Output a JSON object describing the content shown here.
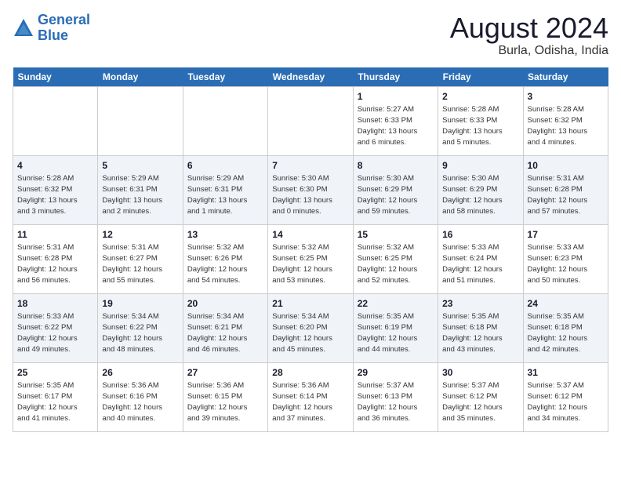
{
  "logo": {
    "text_general": "General",
    "text_blue": "Blue"
  },
  "title": {
    "month_year": "August 2024",
    "location": "Burla, Odisha, India"
  },
  "days_of_week": [
    "Sunday",
    "Monday",
    "Tuesday",
    "Wednesday",
    "Thursday",
    "Friday",
    "Saturday"
  ],
  "weeks": [
    [
      {
        "day": "",
        "info": ""
      },
      {
        "day": "",
        "info": ""
      },
      {
        "day": "",
        "info": ""
      },
      {
        "day": "",
        "info": ""
      },
      {
        "day": "1",
        "info": "Sunrise: 5:27 AM\nSunset: 6:33 PM\nDaylight: 13 hours\nand 6 minutes."
      },
      {
        "day": "2",
        "info": "Sunrise: 5:28 AM\nSunset: 6:33 PM\nDaylight: 13 hours\nand 5 minutes."
      },
      {
        "day": "3",
        "info": "Sunrise: 5:28 AM\nSunset: 6:32 PM\nDaylight: 13 hours\nand 4 minutes."
      }
    ],
    [
      {
        "day": "4",
        "info": "Sunrise: 5:28 AM\nSunset: 6:32 PM\nDaylight: 13 hours\nand 3 minutes."
      },
      {
        "day": "5",
        "info": "Sunrise: 5:29 AM\nSunset: 6:31 PM\nDaylight: 13 hours\nand 2 minutes."
      },
      {
        "day": "6",
        "info": "Sunrise: 5:29 AM\nSunset: 6:31 PM\nDaylight: 13 hours\nand 1 minute."
      },
      {
        "day": "7",
        "info": "Sunrise: 5:30 AM\nSunset: 6:30 PM\nDaylight: 13 hours\nand 0 minutes."
      },
      {
        "day": "8",
        "info": "Sunrise: 5:30 AM\nSunset: 6:29 PM\nDaylight: 12 hours\nand 59 minutes."
      },
      {
        "day": "9",
        "info": "Sunrise: 5:30 AM\nSunset: 6:29 PM\nDaylight: 12 hours\nand 58 minutes."
      },
      {
        "day": "10",
        "info": "Sunrise: 5:31 AM\nSunset: 6:28 PM\nDaylight: 12 hours\nand 57 minutes."
      }
    ],
    [
      {
        "day": "11",
        "info": "Sunrise: 5:31 AM\nSunset: 6:28 PM\nDaylight: 12 hours\nand 56 minutes."
      },
      {
        "day": "12",
        "info": "Sunrise: 5:31 AM\nSunset: 6:27 PM\nDaylight: 12 hours\nand 55 minutes."
      },
      {
        "day": "13",
        "info": "Sunrise: 5:32 AM\nSunset: 6:26 PM\nDaylight: 12 hours\nand 54 minutes."
      },
      {
        "day": "14",
        "info": "Sunrise: 5:32 AM\nSunset: 6:25 PM\nDaylight: 12 hours\nand 53 minutes."
      },
      {
        "day": "15",
        "info": "Sunrise: 5:32 AM\nSunset: 6:25 PM\nDaylight: 12 hours\nand 52 minutes."
      },
      {
        "day": "16",
        "info": "Sunrise: 5:33 AM\nSunset: 6:24 PM\nDaylight: 12 hours\nand 51 minutes."
      },
      {
        "day": "17",
        "info": "Sunrise: 5:33 AM\nSunset: 6:23 PM\nDaylight: 12 hours\nand 50 minutes."
      }
    ],
    [
      {
        "day": "18",
        "info": "Sunrise: 5:33 AM\nSunset: 6:22 PM\nDaylight: 12 hours\nand 49 minutes."
      },
      {
        "day": "19",
        "info": "Sunrise: 5:34 AM\nSunset: 6:22 PM\nDaylight: 12 hours\nand 48 minutes."
      },
      {
        "day": "20",
        "info": "Sunrise: 5:34 AM\nSunset: 6:21 PM\nDaylight: 12 hours\nand 46 minutes."
      },
      {
        "day": "21",
        "info": "Sunrise: 5:34 AM\nSunset: 6:20 PM\nDaylight: 12 hours\nand 45 minutes."
      },
      {
        "day": "22",
        "info": "Sunrise: 5:35 AM\nSunset: 6:19 PM\nDaylight: 12 hours\nand 44 minutes."
      },
      {
        "day": "23",
        "info": "Sunrise: 5:35 AM\nSunset: 6:18 PM\nDaylight: 12 hours\nand 43 minutes."
      },
      {
        "day": "24",
        "info": "Sunrise: 5:35 AM\nSunset: 6:18 PM\nDaylight: 12 hours\nand 42 minutes."
      }
    ],
    [
      {
        "day": "25",
        "info": "Sunrise: 5:35 AM\nSunset: 6:17 PM\nDaylight: 12 hours\nand 41 minutes."
      },
      {
        "day": "26",
        "info": "Sunrise: 5:36 AM\nSunset: 6:16 PM\nDaylight: 12 hours\nand 40 minutes."
      },
      {
        "day": "27",
        "info": "Sunrise: 5:36 AM\nSunset: 6:15 PM\nDaylight: 12 hours\nand 39 minutes."
      },
      {
        "day": "28",
        "info": "Sunrise: 5:36 AM\nSunset: 6:14 PM\nDaylight: 12 hours\nand 37 minutes."
      },
      {
        "day": "29",
        "info": "Sunrise: 5:37 AM\nSunset: 6:13 PM\nDaylight: 12 hours\nand 36 minutes."
      },
      {
        "day": "30",
        "info": "Sunrise: 5:37 AM\nSunset: 6:12 PM\nDaylight: 12 hours\nand 35 minutes."
      },
      {
        "day": "31",
        "info": "Sunrise: 5:37 AM\nSunset: 6:12 PM\nDaylight: 12 hours\nand 34 minutes."
      }
    ]
  ]
}
